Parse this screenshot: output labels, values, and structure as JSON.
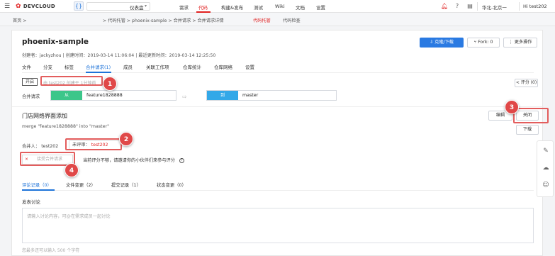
{
  "topbar": {
    "menu_icon": "hamburger-menu-icon",
    "logo_text": "DEVCLOUD",
    "code_icon_glyph": "{}",
    "nav": [
      {
        "label": "仪表盘"
      },
      {
        "label": "需求"
      },
      {
        "label": "代码"
      },
      {
        "label": "构建&发布"
      },
      {
        "label": "测试"
      },
      {
        "label": "Wiki"
      },
      {
        "label": "文档"
      },
      {
        "label": "设置"
      }
    ],
    "region": "华北-北京一",
    "user": "Hi test202"
  },
  "breadcrumb": {
    "items": [
      "首页 >",
      "> 代码托管 > phoenix-sample > 合并请求 > 合并请求详情"
    ],
    "links": [
      "代码托管",
      "代码检查"
    ]
  },
  "repo": {
    "title": "phoenix-sample",
    "meta": "创建者：jackyzhou  |  创建时间：2019-03-14 11:06:04  |  最近更新时间：2019-03-14 12:25:50",
    "clone_label": "克隆/下载",
    "fork_label": "Fork: 0",
    "more_label": "更多操作",
    "tabs": [
      "文件",
      "分支",
      "标签",
      "合并请求(1)",
      "成员",
      "关联工作项",
      "仓库统计",
      "仓库网络",
      "设置"
    ]
  },
  "mr": {
    "status": "开启",
    "created_by": "由 test202 创建于 1分钟前",
    "score_label": "< 评分 (0)",
    "label": "合并请求",
    "from_tag": "从",
    "from_branch": "feature1828888",
    "to_tag": "到",
    "to_branch": "master",
    "title": "门店网络界面添加",
    "merge_text": "merge \"feature1828888\" into \"master\"",
    "edit_label": "编辑",
    "close_label": "关闭",
    "download_label": "下载",
    "merged_by": "合并人：  test202",
    "reviewer_label": "未评审：",
    "reviewer_name": "test202",
    "accept_x": "×",
    "accept_label": "接受合并请求",
    "warn_text": "当前评分不够，请邀请你的小伙伴们来参与评分",
    "tabs": [
      "评论记录（0）",
      "文件变更（2）",
      "提交记录（1）",
      "状态变更（0）"
    ],
    "discuss_title": "发表讨论",
    "discuss_placeholder": "请输入讨论内容，可@在需求成员一起讨论",
    "hint": "您最多还可以输入 500 个字符"
  },
  "annotations": [
    "1",
    "2",
    "3",
    "4"
  ],
  "colors": {
    "accent_red": "#e02020",
    "primary_blue": "#2a7ae2",
    "from_green": "#3cc68a",
    "to_blue": "#33a8e8",
    "badge_red": "#e04848"
  }
}
